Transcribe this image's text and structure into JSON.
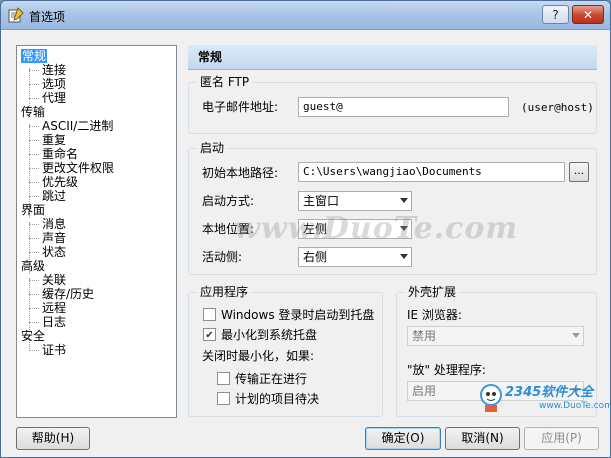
{
  "window": {
    "title": "首选项",
    "help_label": "?",
    "close_label": "✕"
  },
  "tree": {
    "items": [
      {
        "label": "常规",
        "level": 0,
        "selected": true
      },
      {
        "label": "连接",
        "level": 1
      },
      {
        "label": "选项",
        "level": 1
      },
      {
        "label": "代理",
        "level": 1
      },
      {
        "label": "传输",
        "level": 0
      },
      {
        "label": "ASCII/二进制",
        "level": 1
      },
      {
        "label": "重复",
        "level": 1
      },
      {
        "label": "重命名",
        "level": 1
      },
      {
        "label": "更改文件权限",
        "level": 1
      },
      {
        "label": "优先级",
        "level": 1
      },
      {
        "label": "跳过",
        "level": 1
      },
      {
        "label": "界面",
        "level": 0
      },
      {
        "label": "消息",
        "level": 1
      },
      {
        "label": "声音",
        "level": 1
      },
      {
        "label": "状态",
        "level": 1
      },
      {
        "label": "高级",
        "level": 0
      },
      {
        "label": "关联",
        "level": 1
      },
      {
        "label": "缓存/历史",
        "level": 1
      },
      {
        "label": "远程",
        "level": 1
      },
      {
        "label": "日志",
        "level": 1
      },
      {
        "label": "安全",
        "level": 0
      },
      {
        "label": "证书",
        "level": 1
      }
    ]
  },
  "panel": {
    "title": "常规",
    "anon_ftp": {
      "group_title": "匿名 FTP",
      "email_label": "电子邮件地址:",
      "email_value": "guest@",
      "email_hint": "(user@host)"
    },
    "startup": {
      "group_title": "启动",
      "local_path_label": "初始本地路径:",
      "local_path_value": "C:\\Users\\wangjiao\\Documents",
      "browse_label": "...",
      "mode_label": "启动方式:",
      "mode_value": "主窗口",
      "local_pos_label": "本地位置:",
      "local_pos_value": "左侧",
      "active_side_label": "活动侧:",
      "active_side_value": "右侧"
    },
    "app": {
      "group_title": "应用程序",
      "cb_startup_label": "Windows 登录时启动到托盘",
      "cb_startup_checked": false,
      "cb_minimize_label": "最小化到系统托盘",
      "cb_minimize_checked": true,
      "close_min_label": "关闭时最小化，如果:",
      "cb_transfer_label": "传输正在进行",
      "cb_transfer_checked": false,
      "cb_scheduled_label": "计划的项目待决",
      "cb_scheduled_checked": false
    },
    "shell": {
      "group_title": "外壳扩展",
      "ie_label": "IE 浏览器:",
      "ie_value": "禁用",
      "handler_label": "\"放\" 处理程序:",
      "handler_value": "启用"
    }
  },
  "buttons": {
    "help": "帮助(H)",
    "ok": "确定(O)",
    "cancel": "取消(N)",
    "apply": "应用(P)"
  },
  "watermark": "www.DuoTe.com",
  "logo": {
    "big": "2345软件大全",
    "small": "www.DuoTe.com"
  }
}
